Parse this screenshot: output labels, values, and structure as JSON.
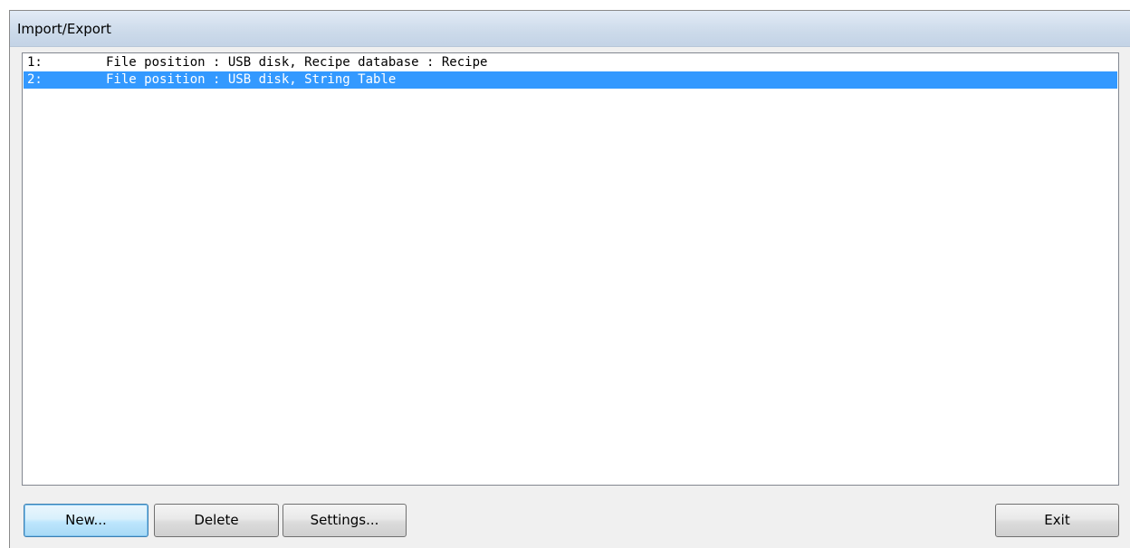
{
  "window": {
    "title": "Import/Export"
  },
  "list": {
    "items": [
      {
        "index": "1:",
        "text": "File position : USB disk, Recipe database : Recipe",
        "selected": false
      },
      {
        "index": "2:",
        "text": "File position : USB disk, String Table",
        "selected": true
      }
    ]
  },
  "buttons": {
    "new_label": "New...",
    "delete_label": "Delete",
    "settings_label": "Settings...",
    "exit_label": "Exit"
  },
  "colors": {
    "selection_background": "#3399ff",
    "selection_text": "#ffffff",
    "titlebar": "#ccdaea"
  }
}
